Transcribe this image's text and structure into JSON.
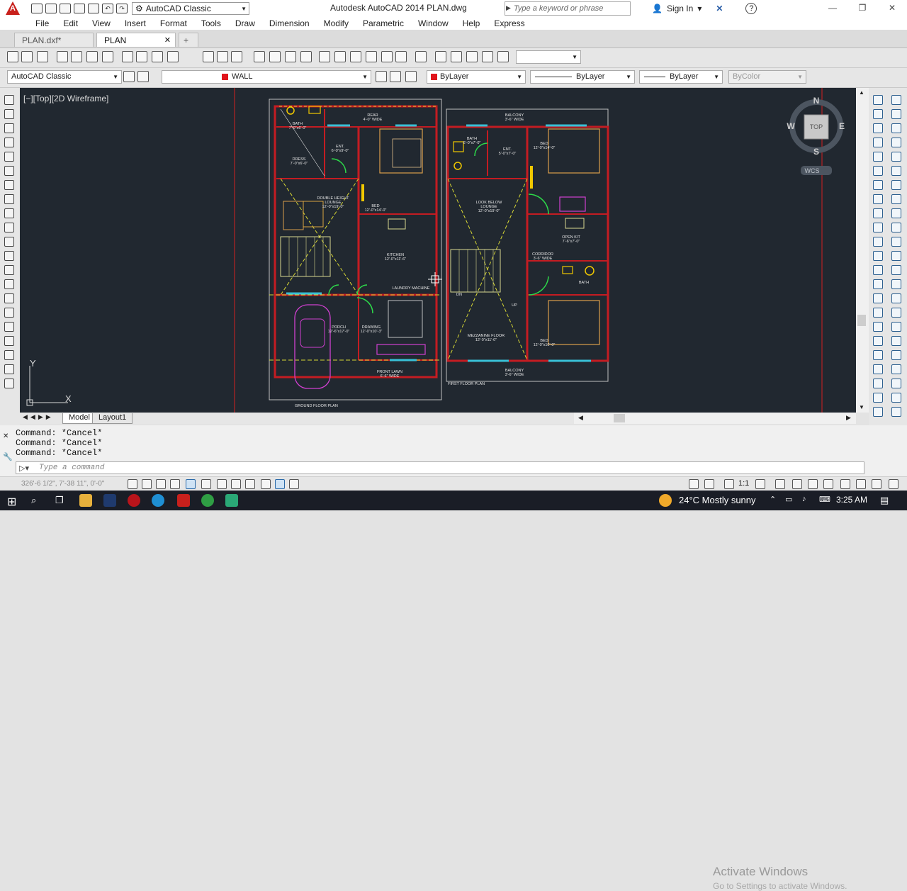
{
  "app": {
    "workspace": "AutoCAD Classic",
    "title": "Autodesk AutoCAD 2014    PLAN.dwg"
  },
  "search": {
    "placeholder": "Type a keyword or phrase"
  },
  "signin": {
    "label": "Sign In"
  },
  "menu": [
    "File",
    "Edit",
    "View",
    "Insert",
    "Format",
    "Tools",
    "Draw",
    "Dimension",
    "Modify",
    "Parametric",
    "Window",
    "Help",
    "Express"
  ],
  "doc_tabs": [
    {
      "label": "PLAN.dxf*"
    },
    {
      "label": "PLAN"
    }
  ],
  "props": {
    "workspace_combo": "AutoCAD Classic",
    "layer": "WALL",
    "color": "ByLayer",
    "linetype": "ByLayer",
    "lineweight": "ByLayer",
    "plotstyle": "ByColor"
  },
  "viewport": {
    "label": "[−][Top][2D Wireframe]"
  },
  "viewcube": {
    "n": "N",
    "s": "S",
    "e": "E",
    "w": "W",
    "top": "TOP",
    "wcs": "WCS"
  },
  "ucs": {
    "x": "X",
    "y": "Y"
  },
  "plan_labels": {
    "ground": "GROUND FLOOR PLAN",
    "first": "FIRST FLOOR PLAN",
    "rear": "REAR",
    "rear_dim": "4'-0\" WIDE",
    "bath": "BATH",
    "bath_dim": "7'-0\"x6'-0\"",
    "ent": "ENT.",
    "ent_dim": "6'-0\"x9'-0\"",
    "dress": "DRESS",
    "dress_dim": "7'-0\"x6'-0\"",
    "dh": "DOUBLE HEIGHT",
    "lounge": "LOUNGE",
    "lounge_dim": "12'-0\"x19'-0\"",
    "bed": "BED",
    "bed_dim": "12'-0\"x14'-0\"",
    "kitchen": "KITCHEN",
    "kitchen_dim": "12'-0\"x11'-6\"",
    "laundry": "LAUNDRY MACHINE",
    "porch": "PORCH",
    "porch_dim": "12'-6\"x17'-0\"",
    "drawing": "DRAWING",
    "drawing_dim": "12'-0\"x10'-3\"",
    "lawn": "FRONT LAWN",
    "lawn_dim": "6'-6\" WIDE",
    "balcony": "BALCONY",
    "balcony_dim": "3'-6\" WIDE",
    "bath2_dim": "6'-0\"x7'-0\"",
    "ent2_dim": "5'-0\"x7'-0\"",
    "bed2_dim": "12'-0\"x14'-0\"",
    "look": "LOOK BELOW",
    "look2": "LOUNGE",
    "look_dim": "12'-0\"x19'-0\"",
    "openkit": "OPEN KIT",
    "openkit_dim": "7'-6\"x7'-0\"",
    "corridor": "CORRIDOR",
    "corridor_dim": "3'-6\" WIDE",
    "mezz": "MEZZANINE FLOOR",
    "mezz_dim": "12'-0\"x11'-0\"",
    "bed3_dim": "12'-0\"x10'-0\"",
    "up": "UP",
    "dn": "DN"
  },
  "layout_tabs": [
    "Model",
    "Layout1"
  ],
  "command": {
    "history": [
      "Command: *Cancel*",
      "Command: *Cancel*",
      "Command: *Cancel*"
    ],
    "placeholder": "Type a command"
  },
  "activation": {
    "line1": "Activate Windows",
    "line2": "Go to Settings to activate Windows."
  },
  "status": {
    "coords": "326'-6 1/2\", 7'-38 11\", 0'-0\"",
    "scale": "1:1"
  },
  "taskbar": {
    "weather": "24°C  Mostly sunny",
    "time": "3:25 AM"
  }
}
